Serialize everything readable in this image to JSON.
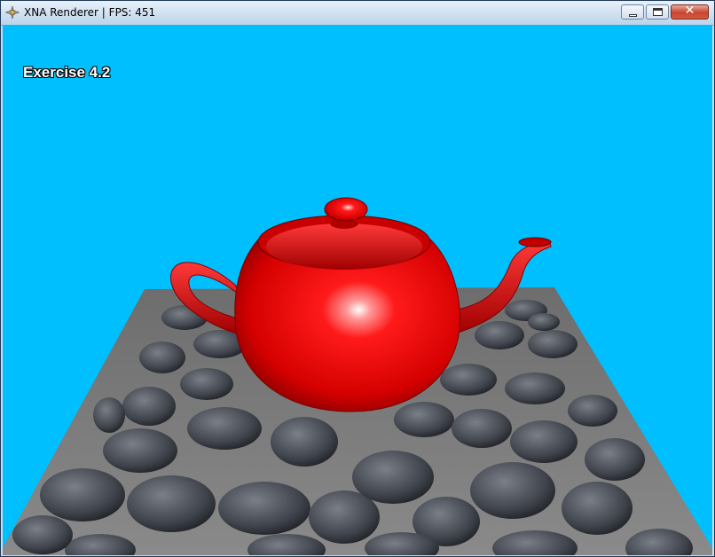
{
  "window": {
    "title": "XNA Renderer | FPS: 451",
    "icon": "xna-app-icon",
    "controls": {
      "minimize_icon": "minimize-icon",
      "maximize_icon": "maximize-icon",
      "close_icon": "close-icon",
      "close_glyph": "✕"
    }
  },
  "viewport": {
    "clear_color": "#00bfff",
    "overlay_text": "Exercise 4.2",
    "scene": {
      "object": "teapot",
      "object_color": "#e00000",
      "ground": "cobblestone-plane"
    }
  }
}
